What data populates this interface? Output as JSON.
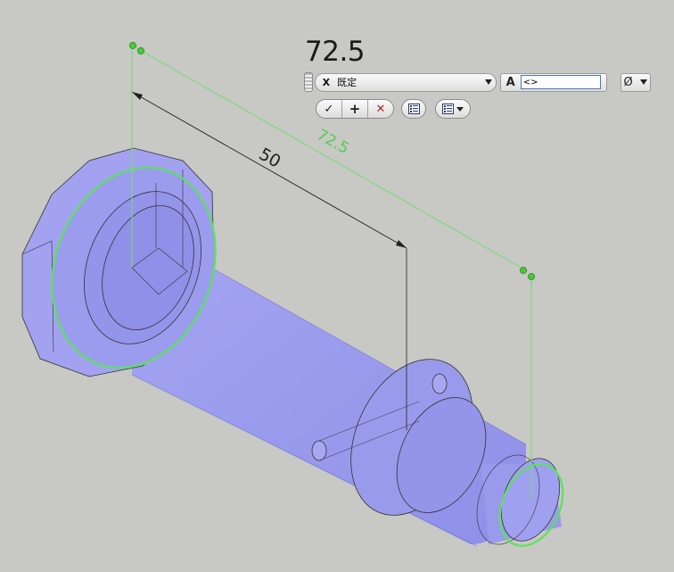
{
  "dimension": {
    "value_readout": "72.5",
    "existing_dimension_label": "50",
    "preview_dimension_label": "72.5"
  },
  "text_style_combo": {
    "prefix": "X",
    "selected": "既定"
  },
  "text_field": {
    "label": "A",
    "value": "<>"
  },
  "symbol_button": {
    "glyph": "Ø"
  },
  "icons": {
    "ok": "check-icon",
    "add": "plus-icon",
    "cancel": "x-icon",
    "list": "list-icon",
    "list_menu": "list-dropdown-icon"
  },
  "colors": {
    "part_fill": "#9e9ef0",
    "dimension_preview": "#55dd55",
    "grip_point": "#44cc33",
    "cancel": "#c02020"
  }
}
